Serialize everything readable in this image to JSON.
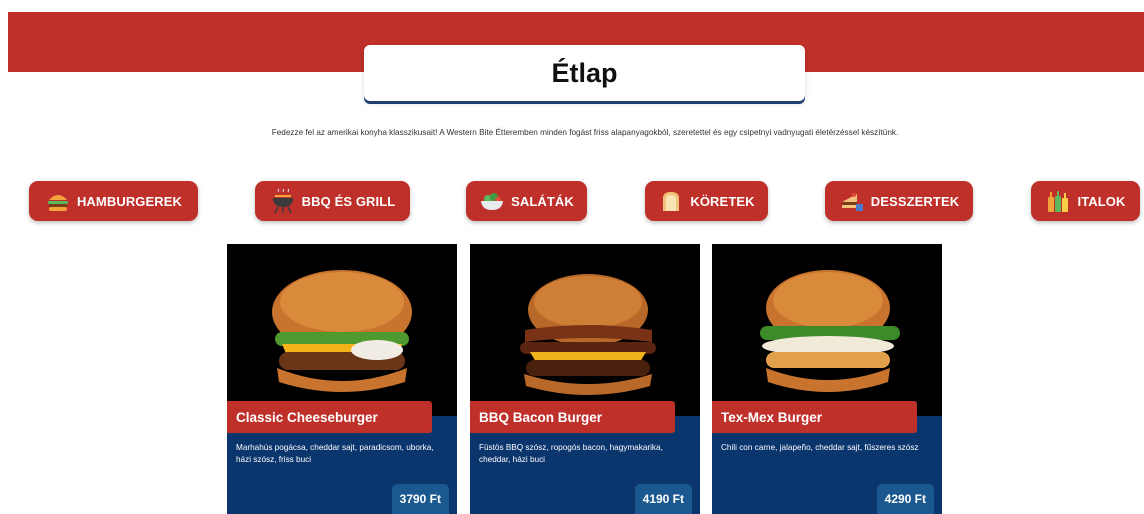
{
  "page": {
    "title": "Étlap",
    "intro": "Fedezze fel az amerikai konyha klasszikusait! A Western Bite Étteremben minden fogást friss alapanyagokból, szeretettel és egy csipetnyi vadnyugati életérzéssel készítünk."
  },
  "categories": [
    {
      "label": "HAMBURGEREK",
      "icon": "burger-icon"
    },
    {
      "label": "BBQ ÉS GRILL",
      "icon": "grill-icon"
    },
    {
      "label": "SALÁTÁK",
      "icon": "salad-bowl-icon"
    },
    {
      "label": "KÖRETEK",
      "icon": "bread-icon"
    },
    {
      "label": "DESSZERTEK",
      "icon": "cake-icon"
    },
    {
      "label": "ITALOK",
      "icon": "bottles-icon"
    }
  ],
  "menu_items": [
    {
      "name": "Classic Cheeseburger",
      "description": "Marhahús pogácsa, cheddar sajt, paradicsom, uborka, házi szósz, friss buci",
      "price": "3790 Ft"
    },
    {
      "name": "BBQ Bacon Burger",
      "description": "Füstös BBQ szósz, ropogós bacon, hagymakarika, cheddar, házi buci",
      "price": "4190 Ft"
    },
    {
      "name": "Tex-Mex Burger",
      "description": "Chili con carne, jalapeño, cheddar sajt, fűszeres szósz",
      "price": "4290 Ft"
    }
  ],
  "colors": {
    "brand_red": "#c0302a",
    "navy": "#0b356d",
    "price_blue": "#1b5890"
  }
}
